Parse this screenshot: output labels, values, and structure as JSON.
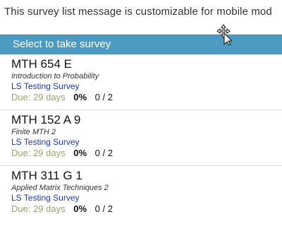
{
  "top_message": "This survey list message is customizable for mobile mod",
  "header": {
    "title": "Select to take survey"
  },
  "items": [
    {
      "code": "MTH 654 E",
      "title": "Introduction to Probability",
      "survey": "LS Testing Survey",
      "due": "Due: 29 days",
      "percent": "0%",
      "count": "0 / 2"
    },
    {
      "code": "MTH 152 A 9",
      "title": "Finite MTH 2",
      "survey": "LS Testing Survey",
      "due": "Due: 29 days",
      "percent": "0%",
      "count": "0 / 2"
    },
    {
      "code": "MTH 311 G 1",
      "title": "Applied Matrix Techniques 2",
      "survey": "LS Testing Survey",
      "due": "Due: 29 days",
      "percent": "0%",
      "count": "0 / 2"
    }
  ],
  "cursor_icon": "move-cursor-icon"
}
